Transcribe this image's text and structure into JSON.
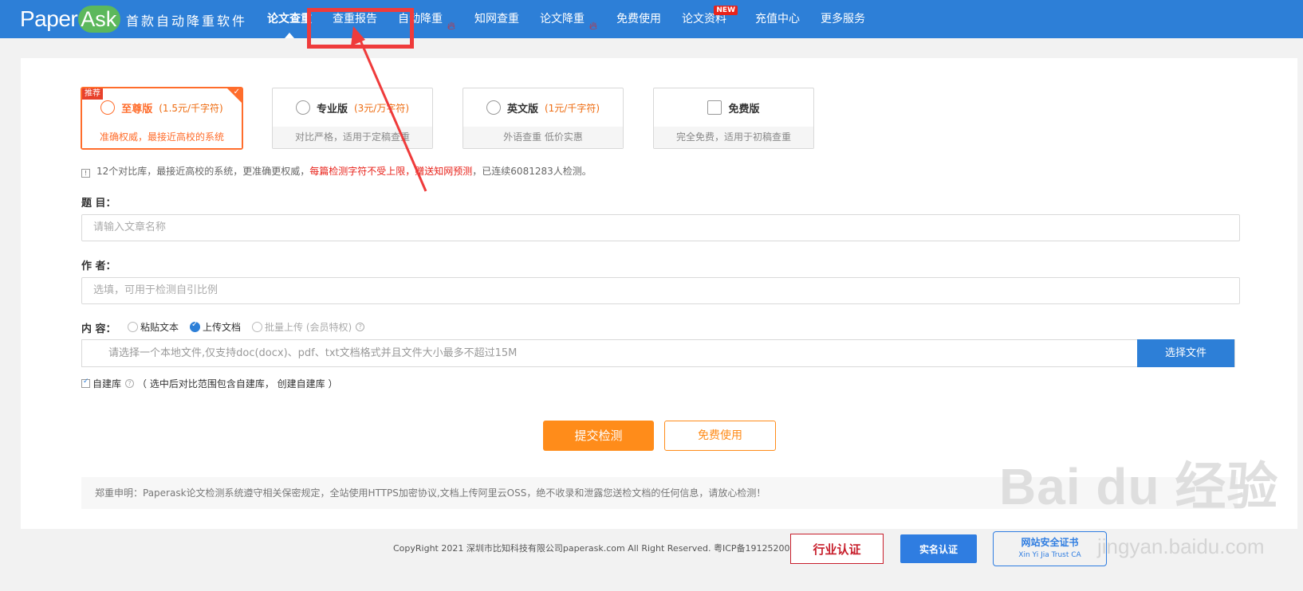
{
  "header": {
    "logo_paper": "Paper",
    "logo_ask": "Ask",
    "slogan": "首款自动降重软件",
    "nav": [
      {
        "label": "论文查重",
        "active": true
      },
      {
        "label": "查重报告"
      },
      {
        "label": "自动降重",
        "hot": true
      },
      {
        "label": "知网查重"
      },
      {
        "label": "论文降重",
        "hot": true
      },
      {
        "label": "免费使用"
      },
      {
        "label": "论文资料",
        "badge": "NEW"
      },
      {
        "label": "充值中心"
      },
      {
        "label": "更多服务"
      }
    ]
  },
  "versions": [
    {
      "name": "至尊版",
      "price": "(1.5元/千字符)",
      "desc": "准确权威，最接近高校的系统",
      "badge": "推荐",
      "selected": true
    },
    {
      "name": "专业版",
      "price": "(3元/万字符)",
      "desc": "对比严格，适用于定稿查重"
    },
    {
      "name": "英文版",
      "price": "(1元/千字符)",
      "desc": "外语查重 低价实惠"
    },
    {
      "name": "免费版",
      "price": "",
      "desc": "完全免费，适用于初稿查重"
    }
  ],
  "info": {
    "text1": "12个对比库，最接近高校的系统，更准确更权威，",
    "red": "每篇检测字符不受上限，赠送知网预测",
    "text2": "，已连续6081283人检测。"
  },
  "form": {
    "title_label": "题 目：",
    "title_placeholder": "请输入文章名称",
    "author_label": "作 者：",
    "author_placeholder": "选填，可用于检测自引比例",
    "content_label": "内 容：",
    "content_options": [
      {
        "label": "粘贴文本",
        "checked": false,
        "disabled": false
      },
      {
        "label": "上传文档",
        "checked": true,
        "disabled": false
      },
      {
        "label": "批量上传 (会员特权)",
        "checked": false,
        "disabled": true
      }
    ],
    "file_hint": "请选择一个本地文件,仅支持doc(docx)、pdf、txt文档格式并且文件大小最多不超过15M",
    "file_button": "选择文件",
    "selfdb_label": "自建库",
    "selfdb_note": "（ 选中后对比范围包含自建库， 创建自建库 ）",
    "submit": "提交检测",
    "free": "免费使用"
  },
  "disclaimer": "郑重申明：Paperask论文检测系统遵守相关保密规定，全站使用HTTPS加密协议,文档上传阿里云OSS，绝不收录和泄露您送检文档的任何信息，请放心检测！",
  "footer": {
    "copyright": "CopyRight 2021 深圳市比知科技有限公司paperask.com All Right Reserved. 粤ICP备19125200号-1",
    "badges": [
      "行业认证",
      "实名认证",
      "网站安全证书",
      "Xin Yi Jia Trust CA"
    ]
  },
  "watermark": {
    "main": "Bai du 经验",
    "sub": "jingyan.baidu.com"
  },
  "colors": {
    "primary": "#2d7fd7",
    "accent": "#ff8c1a",
    "highlight": "#ff6d2c",
    "annotation": "#ef3b3b"
  }
}
